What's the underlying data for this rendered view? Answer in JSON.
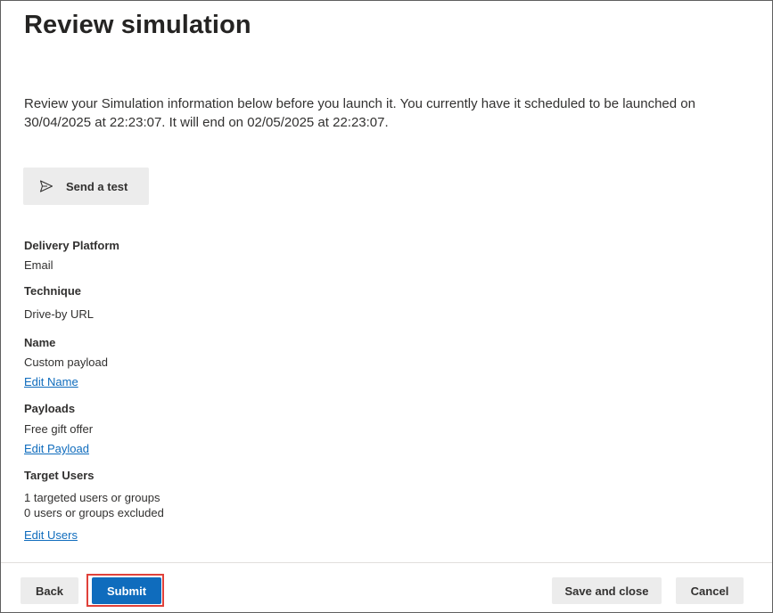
{
  "page": {
    "title": "Review simulation",
    "intro_line1": "Review your Simulation information below before you launch it. You currently have it scheduled to be launched on",
    "intro_line2": "30/04/2025 at 22:23:07. It will end on 02/05/2025 at 22:23:07."
  },
  "send_test": {
    "label": "Send a test",
    "icon": "send-icon"
  },
  "details": {
    "delivery_platform": {
      "label": "Delivery Platform",
      "value": "Email"
    },
    "technique": {
      "label": "Technique",
      "value": "Drive-by URL"
    },
    "name": {
      "label": "Name",
      "value": "Custom payload",
      "edit_link": "Edit Name"
    },
    "payloads": {
      "label": "Payloads",
      "value": "Free gift offer",
      "edit_link": "Edit Payload"
    },
    "target_users": {
      "label": "Target Users",
      "value_line1": "1 targeted users or groups",
      "value_line2": "0 users or groups excluded",
      "edit_link": "Edit Users"
    }
  },
  "footer": {
    "back_label": "Back",
    "submit_label": "Submit",
    "save_close_label": "Save and close",
    "cancel_label": "Cancel"
  },
  "colors": {
    "primary": "#0f6cbd",
    "link": "#0f6cbd",
    "highlight": "#e0413a",
    "secondary_button": "#ececec"
  }
}
